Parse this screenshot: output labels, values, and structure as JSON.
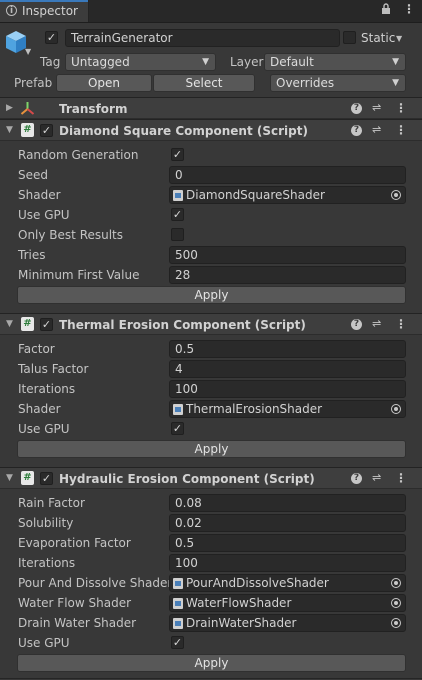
{
  "window": {
    "tab_title": "Inspector"
  },
  "gameobject": {
    "active": true,
    "name": "TerrainGenerator",
    "static_label": "Static",
    "static": false,
    "tag_label": "Tag",
    "tag_value": "Untagged",
    "layer_label": "Layer",
    "layer_value": "Default",
    "prefab_label": "Prefab",
    "open_label": "Open",
    "select_label": "Select",
    "overrides_label": "Overrides"
  },
  "transform": {
    "title": "Transform"
  },
  "diamond_square": {
    "title": "Diamond Square Component (Script)",
    "enabled": true,
    "random_generation_label": "Random Generation",
    "random_generation": true,
    "seed_label": "Seed",
    "seed_value": "0",
    "shader_label": "Shader",
    "shader_value": "DiamondSquareShader",
    "use_gpu_label": "Use GPU",
    "use_gpu": true,
    "only_best_label": "Only Best Results",
    "only_best": false,
    "tries_label": "Tries",
    "tries_value": "500",
    "min_first_label": "Minimum First Value",
    "min_first_value": "28",
    "apply_label": "Apply"
  },
  "thermal_erosion": {
    "title": "Thermal Erosion Component (Script)",
    "enabled": true,
    "factor_label": "Factor",
    "factor_value": "0.5",
    "talus_label": "Talus Factor",
    "talus_value": "4",
    "iterations_label": "Iterations",
    "iterations_value": "100",
    "shader_label": "Shader",
    "shader_value": "ThermalErosionShader",
    "use_gpu_label": "Use GPU",
    "use_gpu": true,
    "apply_label": "Apply"
  },
  "hydraulic_erosion": {
    "title": "Hydraulic Erosion Component (Script)",
    "enabled": true,
    "rain_label": "Rain Factor",
    "rain_value": "0.08",
    "solubility_label": "Solubility",
    "solubility_value": "0.02",
    "evaporation_label": "Evaporation Factor",
    "evaporation_value": "0.5",
    "iterations_label": "Iterations",
    "iterations_value": "100",
    "pour_label": "Pour And Dissolve Shader",
    "pour_value": "PourAndDissolveShader",
    "water_flow_label": "Water Flow Shader",
    "water_flow_value": "WaterFlowShader",
    "drain_label": "Drain Water Shader",
    "drain_value": "DrainWaterShader",
    "use_gpu_label": "Use GPU",
    "use_gpu": true,
    "apply_label": "Apply"
  },
  "icons": {
    "tab": "info-icon",
    "toolbar": [
      "lock-icon",
      "kebab-menu-icon"
    ],
    "header_actions": [
      "help-icon",
      "presets-icon",
      "kebab-menu-icon"
    ],
    "script": "csharp-script-icon",
    "gameobject": "gameobject-cube-icon",
    "object_field": "shader-asset-icon",
    "picker": "object-picker-icon"
  },
  "colors": {
    "background": "#383838",
    "accent": "#3a79bb",
    "field": "#2a2a2a",
    "header": "#3e3e3e"
  }
}
